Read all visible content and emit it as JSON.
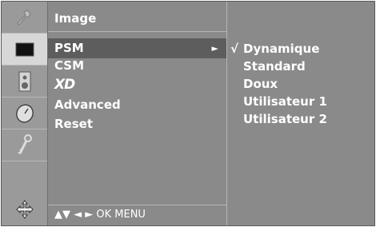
{
  "icons": [
    {
      "name": "tool-icon"
    },
    {
      "name": "picture-icon"
    },
    {
      "name": "speaker-icon"
    },
    {
      "name": "clock-icon"
    },
    {
      "name": "key-icon"
    },
    {
      "name": "input-icon"
    }
  ],
  "menu": {
    "title": "Image",
    "items": [
      {
        "label": "PSM",
        "arrow": "►"
      },
      {
        "label": "CSM"
      },
      {
        "label": "XD"
      },
      {
        "label": "Advanced"
      },
      {
        "label": "Reset"
      }
    ],
    "nav_hint": "▲▼  ◄ ►  OK  MENU"
  },
  "submenu": {
    "check_mark": "√",
    "items": [
      {
        "label": "Dynamique",
        "checked": true
      },
      {
        "label": "Standard"
      },
      {
        "label": "Doux"
      },
      {
        "label": "Utilisateur 1"
      },
      {
        "label": "Utilisateur 2"
      }
    ]
  }
}
